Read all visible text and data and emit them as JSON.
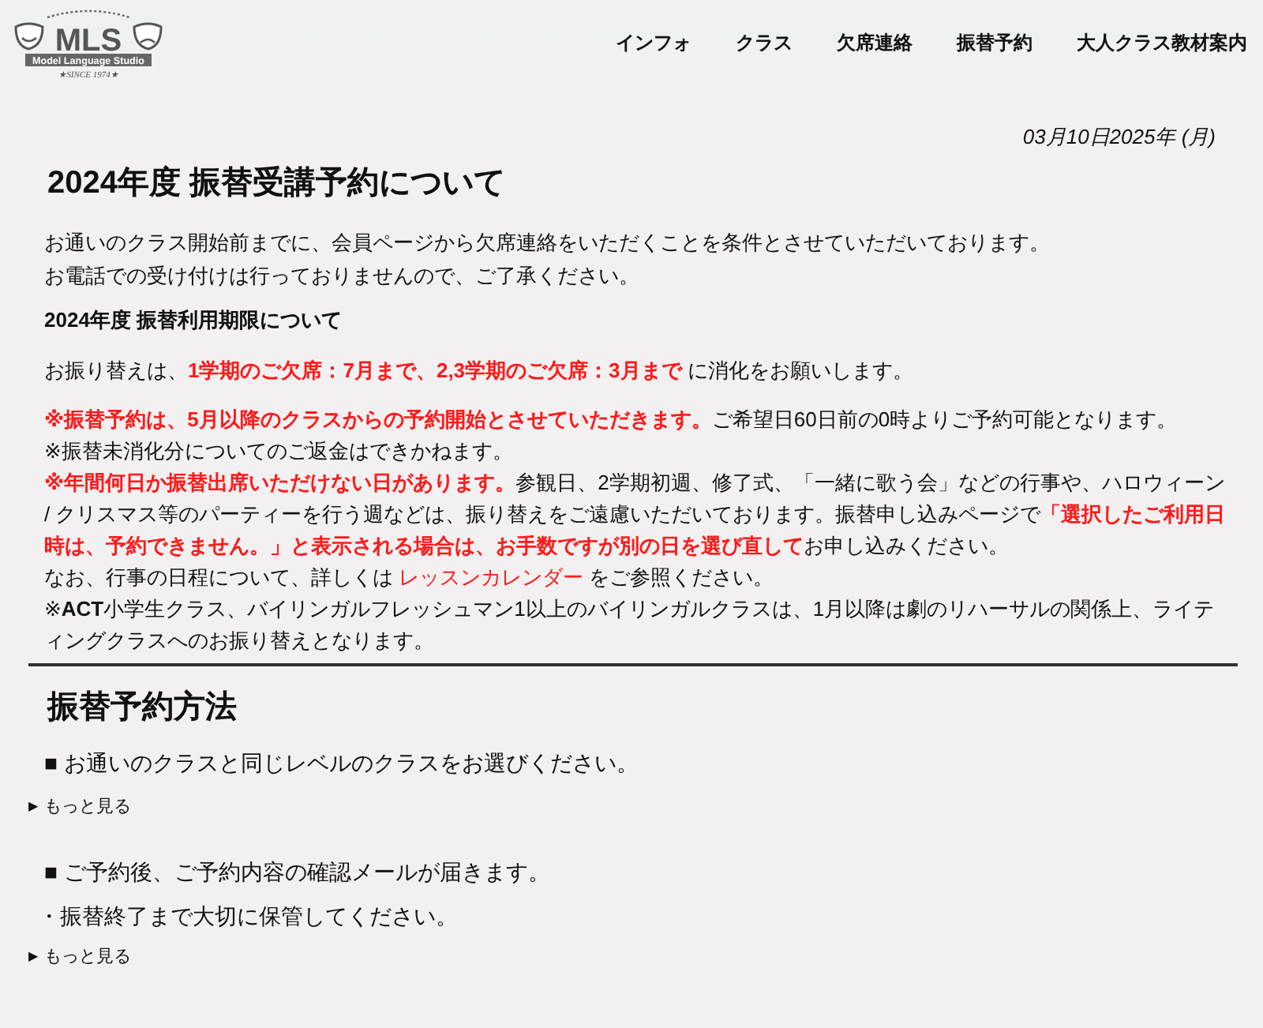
{
  "header": {
    "logo": {
      "name": "MLS",
      "tagline": "Model Language Studio",
      "since": "★SINCE 1974★"
    },
    "nav": [
      {
        "label": "インフォ"
      },
      {
        "label": "クラス"
      },
      {
        "label": "欠席連絡"
      },
      {
        "label": "振替予約"
      },
      {
        "label": "大人クラス教材案内"
      }
    ]
  },
  "date": "03月10日2025年 (月)",
  "title": "2024年度 振替受講予約について",
  "intro": [
    "お通いのクラス開始前までに、会員ページから欠席連絡をいただくことを条件とさせていただいております。",
    "お電話での受け付けは行っておりませんので、ご了承ください。"
  ],
  "subheading": "2024年度 振替利用期限について",
  "deadline": [
    {
      "kind": "plain",
      "text": "お振り替えは、"
    },
    {
      "kind": "red",
      "text": "1学期のご欠席：7月まで、2,3学期のご欠席：3月まで"
    },
    {
      "kind": "plain",
      "text": " に消化をお願いします。"
    }
  ],
  "notes": [
    [
      {
        "kind": "red",
        "text": "※振替予約は、5月以降のクラスからの予約開始とさせていただきます。"
      },
      {
        "kind": "plain",
        "text": "ご希望日60日前の0時よりご予約可能となります。"
      }
    ],
    [
      {
        "kind": "plain",
        "text": "※振替未消化分についてのご返金はできかねます。"
      }
    ],
    [
      {
        "kind": "red",
        "text": "※年間何日か振替出席いただけない日があります。"
      },
      {
        "kind": "plain",
        "text": "参観日、2学期初週、修了式、「一緒に歌う会」などの行事や、ハロウィーン / クリスマス等のパーティーを行う週などは、振り替えをご遠慮いただいております。振替申し込みページで"
      },
      {
        "kind": "red",
        "text": "「選択したご利用日時は、予約できません。」と表示される場合は、お手数ですが別の日を選び直して"
      },
      {
        "kind": "plain",
        "text": "お申し込みください。"
      }
    ],
    [
      {
        "kind": "plain",
        "text": "なお、行事の日程について、詳しくは "
      },
      {
        "kind": "link",
        "text": "レッスンカレンダー"
      },
      {
        "kind": "plain",
        "text": " をご参照ください。"
      }
    ],
    [
      {
        "kind": "plain",
        "text": "※**ACT**小学生クラス、バイリンガルフレッシュマン1以上のバイリンガルクラスは、1月以降は劇のリハーサルの関係上、ライティングクラスへのお振り替えとなります。"
      }
    ]
  ],
  "section": {
    "title": "振替予約方法",
    "items": [
      {
        "kind": "heading",
        "text": "■ お通いのクラスと同じレベルのクラスをお選びください。"
      },
      {
        "kind": "toggle",
        "marker": "▶",
        "label": "もっと見る"
      },
      {
        "kind": "heading",
        "text": "■ ご予約後、ご予約内容の確認メールが届きます。"
      },
      {
        "kind": "bullet",
        "text": "・振替終了まで大切に保管してください。"
      },
      {
        "kind": "toggle",
        "marker": "▶",
        "label": "もっと見る"
      }
    ]
  }
}
